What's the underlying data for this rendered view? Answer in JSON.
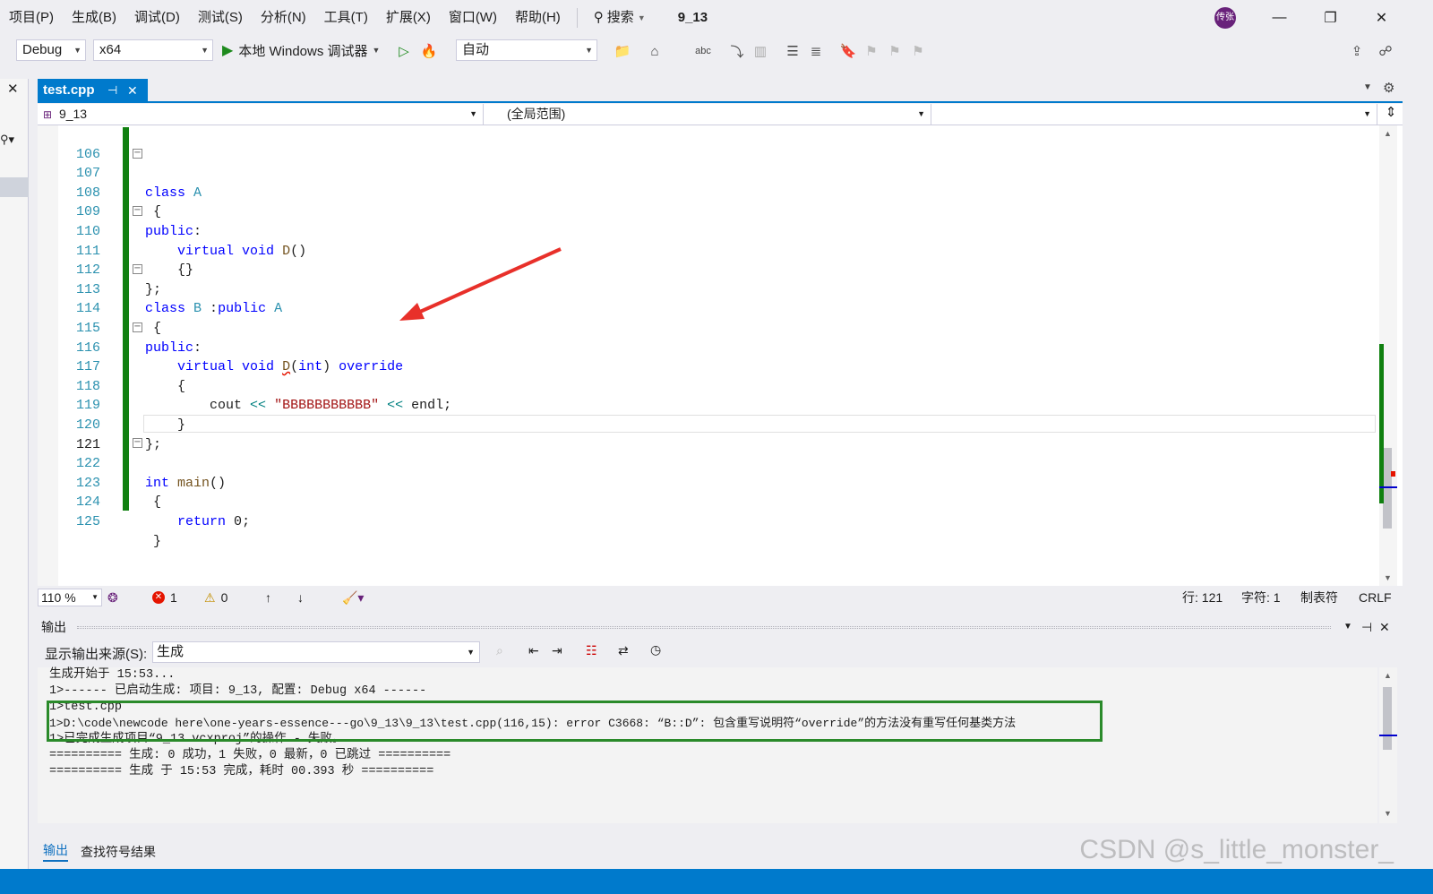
{
  "menubar": {
    "items": [
      "项目(P)",
      "生成(B)",
      "调试(D)",
      "测试(S)",
      "分析(N)",
      "工具(T)",
      "扩展(X)",
      "窗口(W)",
      "帮助(H)"
    ],
    "search_label": "搜索",
    "solution_name": "9_13",
    "avatar_text": "传张",
    "avatar_color": "#68217a"
  },
  "toolbar": {
    "config": "Debug",
    "platform": "x64",
    "debugger_label": "本地 Windows 调试器",
    "auto_label": "自动",
    "accent_green": "#1e8a1e"
  },
  "tabs": [
    {
      "label": "test.cpp",
      "active": true
    }
  ],
  "navbar": {
    "project": "9_13",
    "scope": "(全局范围)",
    "member": ""
  },
  "editor": {
    "lines": [
      {
        "n": "106"
      },
      {
        "n": "107"
      },
      {
        "n": "108"
      },
      {
        "n": "109"
      },
      {
        "n": "110"
      },
      {
        "n": "111"
      },
      {
        "n": "112"
      },
      {
        "n": "113"
      },
      {
        "n": "114"
      },
      {
        "n": "115"
      },
      {
        "n": "116"
      },
      {
        "n": "117"
      },
      {
        "n": "118"
      },
      {
        "n": "119"
      },
      {
        "n": "120"
      },
      {
        "n": "121"
      },
      {
        "n": "122"
      },
      {
        "n": "123"
      },
      {
        "n": "124"
      },
      {
        "n": "125"
      }
    ],
    "tokens": {
      "class": "class",
      "A": "A",
      "B": "B",
      "public": "public",
      "virtual": "virtual",
      "void": "void",
      "D": "D",
      "int": "int",
      "override": "override",
      "cout": "cout",
      "str": "\"BBBBBBBBBBB\"",
      "endl": "endl",
      "main": "main",
      "return": "return",
      "zero": "0"
    }
  },
  "edit_status": {
    "zoom": "110 %",
    "errors": "1",
    "warnings": "0",
    "line": "行: 121",
    "char": "字符: 1",
    "tabs": "制表符",
    "eol": "CRLF"
  },
  "output": {
    "title": "输出",
    "source_label": "显示输出来源(S):",
    "source_value": "生成",
    "lines": [
      "生成开始于 15:53...",
      "1>------ 已启动生成: 项目: 9_13, 配置: Debug x64 ------",
      "1>test.cpp",
      "1>D:\\code\\newcode here\\one-years-essence---go\\9_13\\9_13\\test.cpp(116,15): error C3668: “B::D”: 包含重写说明符“override”的方法没有重写任何基类方法",
      "1>已完成生成项目“9_13.vcxproj”的操作 - 失败。",
      "========== 生成: 0 成功，1 失败，0 最新，0 已跳过 ==========",
      "========== 生成 于 15:53 完成，耗时 00.393 秒 =========="
    ],
    "tabs": [
      "输出",
      "查找符号结果"
    ]
  },
  "watermark": "CSDN @s_little_monster_"
}
